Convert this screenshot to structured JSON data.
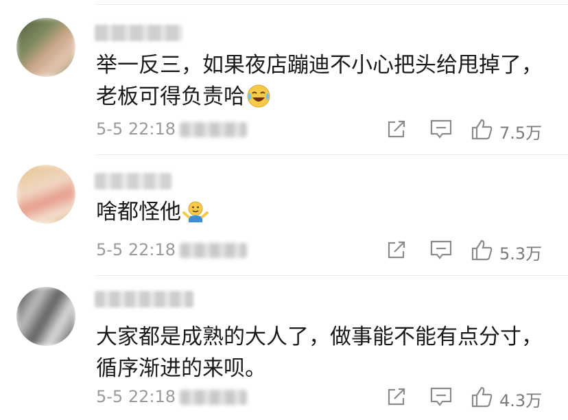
{
  "comments": [
    {
      "text_lines": [
        "举一反三，如果夜店蹦迪不小心把头给甩掉了，",
        "老板可得负责哈"
      ],
      "emoji": "crying-laughing-emoji",
      "timestamp": "5-5 22:18",
      "likes": "7.5万",
      "avatar_colors": [
        "#4f5d3c",
        "#b7967b",
        "#6d7a52",
        "#d2b7a0"
      ]
    },
    {
      "text_lines": [
        "啥都怪他"
      ],
      "emoji": "shrug-emoji",
      "timestamp": "5-5 22:18",
      "likes": "5.3万",
      "avatar_colors": [
        "#e6c48c",
        "#f0d7c3",
        "#d9a877",
        "#f4e2d2"
      ]
    },
    {
      "text_lines": [
        "大家都是成熟的大人了，做事能不能有点分寸，",
        "循序渐进的来呗。"
      ],
      "emoji": "",
      "timestamp": "5-5 22:18",
      "likes": "4.3万",
      "avatar_colors": [
        "#3a3a3a",
        "#bdbdbd",
        "#606060",
        "#dcdcdc"
      ]
    }
  ],
  "icons": {
    "share": "share-icon",
    "reply": "comment-icon",
    "like": "thumbs-up-icon"
  },
  "colors": {
    "text": "#1a1a1a",
    "meta": "#9a9a9a",
    "icon": "#8a8a8a",
    "divider": "#ececec"
  }
}
